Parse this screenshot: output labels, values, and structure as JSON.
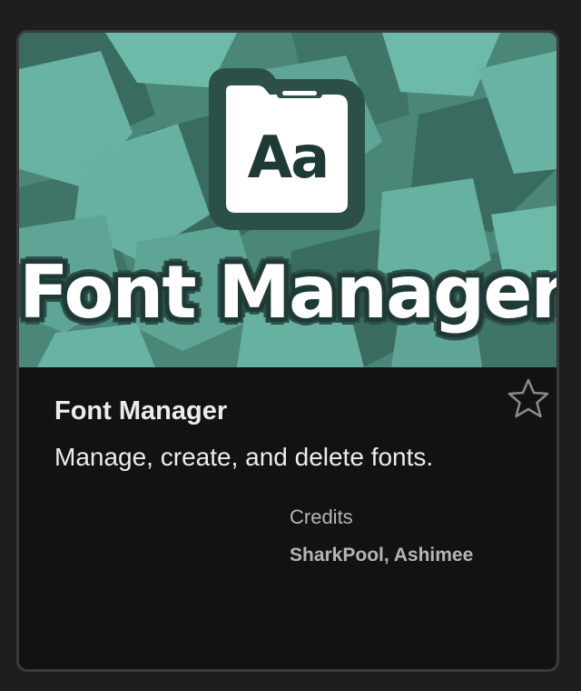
{
  "extension": {
    "banner_title": "Font Manager",
    "banner_icon_text": "Aa",
    "name": "Font Manager",
    "description": "Manage, create, and delete fonts.",
    "credits_label": "Credits",
    "credits": "SharkPool, Ashimee",
    "favorited": false
  },
  "icons": {
    "banner": "folder-font-icon",
    "favorite": "star-outline-icon"
  },
  "colors": {
    "banner_bg": "#4f8f80",
    "banner_shape_light": "#67b5a4",
    "banner_shape_dark": "#3a6d62",
    "card_bg": "#121212",
    "page_bg": "#1e1e1e",
    "text_primary": "#ececec",
    "text_secondary": "#b5b5b5"
  }
}
